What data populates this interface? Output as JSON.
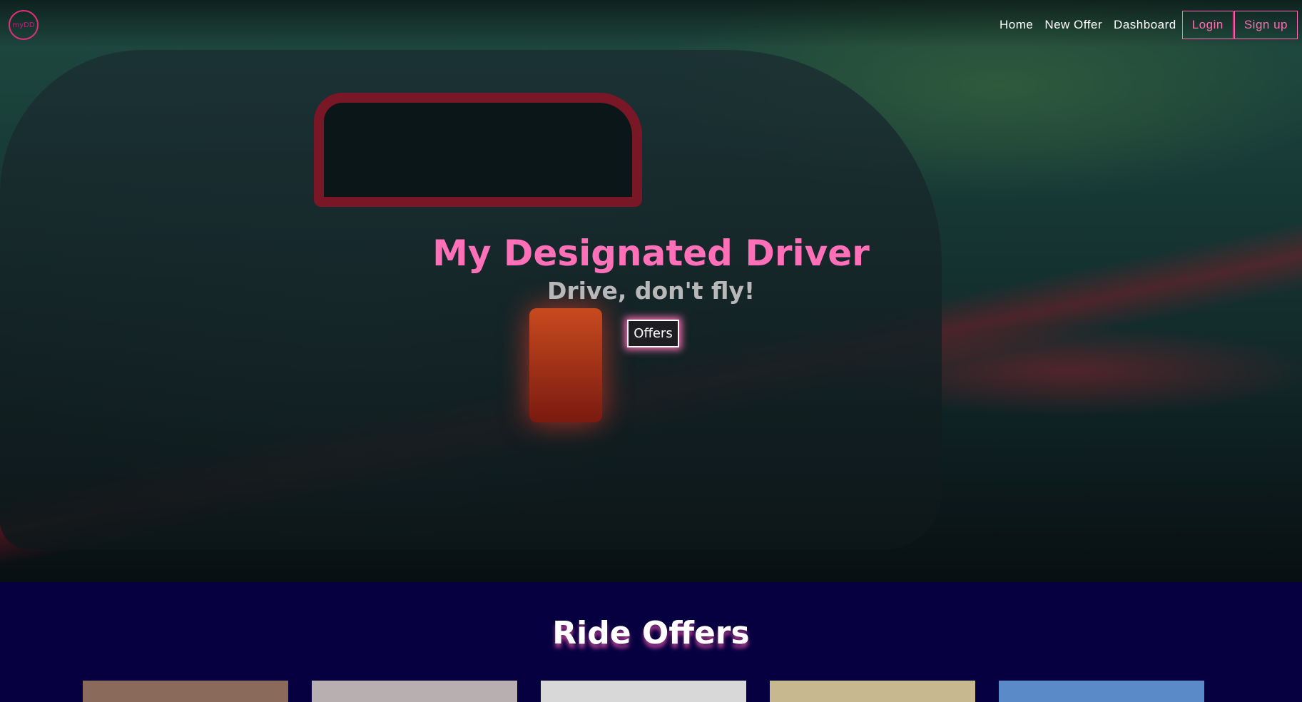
{
  "nav": {
    "logo_text": "myDD",
    "links": [
      "Home",
      "New Offer",
      "Dashboard"
    ],
    "login": "Login",
    "signup": "Sign up",
    "accent": "#ff6eb4"
  },
  "hero": {
    "title": "My Designated Driver",
    "subtitle": "Drive, don't fly!",
    "button": "Offers"
  },
  "section": {
    "title": "Ride Offers",
    "cards": [
      {
        "color": "#8a6a5a"
      },
      {
        "color": "#b8b0b0"
      },
      {
        "color": "#d8d8d8"
      },
      {
        "color": "#c8b890"
      },
      {
        "color": "#5a8ac8"
      }
    ]
  },
  "background": "#070040"
}
